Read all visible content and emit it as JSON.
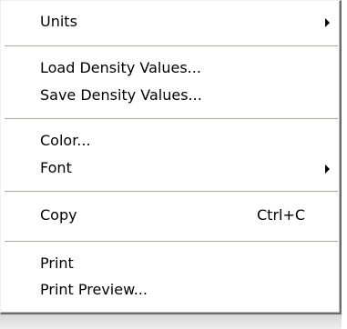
{
  "menu": {
    "units": {
      "label": "Units",
      "submenu_icon": "submenu-arrow-icon"
    },
    "load_density_values": {
      "label": "Load Density Values..."
    },
    "save_density_values": {
      "label": "Save Density Values..."
    },
    "color": {
      "label": "Color..."
    },
    "font": {
      "label": "Font",
      "submenu_icon": "submenu-arrow-icon"
    },
    "copy": {
      "label": "Copy",
      "shortcut": "Ctrl+C"
    },
    "print": {
      "label": "Print"
    },
    "print_preview": {
      "label": "Print Preview..."
    }
  },
  "colors": {
    "menu_background": "#ffffff",
    "text": "#000000",
    "separator": "#aca899",
    "frame_shadow": "#6b6b6b"
  }
}
